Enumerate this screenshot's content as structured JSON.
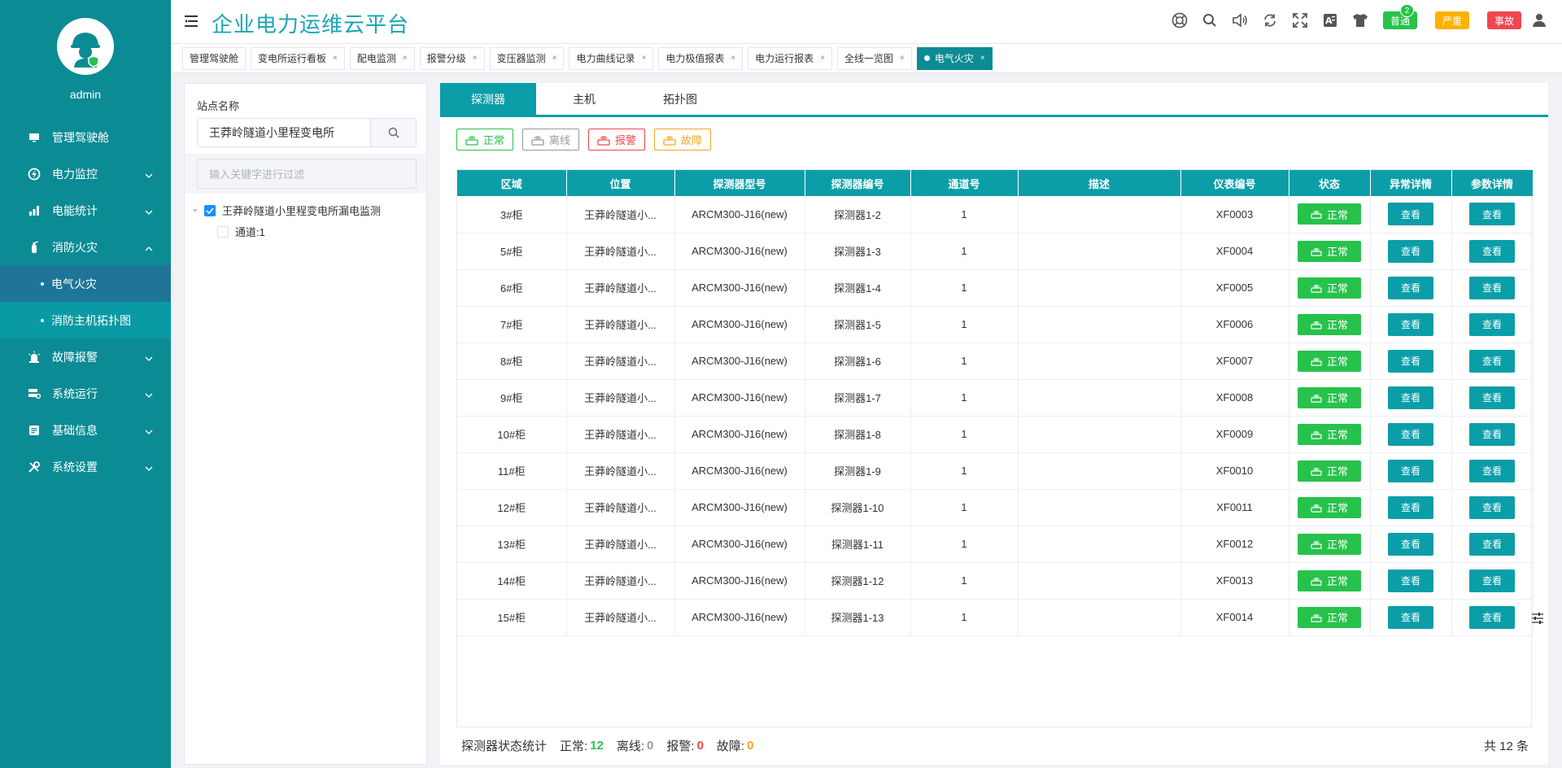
{
  "sidebar": {
    "username": "admin",
    "menu": [
      {
        "label": "管理驾驶舱"
      },
      {
        "label": "电力监控"
      },
      {
        "label": "电能统计"
      },
      {
        "label": "消防火灾"
      },
      {
        "label": "故障报警"
      },
      {
        "label": "系统运行"
      },
      {
        "label": "基础信息"
      },
      {
        "label": "系统设置"
      }
    ],
    "submenu": [
      {
        "label": "电气火灾"
      },
      {
        "label": "消防主机拓扑图"
      }
    ]
  },
  "header": {
    "title": "企业电力运维云平台",
    "badges": {
      "normal": "普通",
      "normal_count": "2",
      "severe": "严重",
      "accident": "事故"
    }
  },
  "tabs": [
    {
      "label": "管理驾驶舱"
    },
    {
      "label": "变电所运行看板",
      "x": "×"
    },
    {
      "label": "配电监测",
      "x": "×"
    },
    {
      "label": "报警分级",
      "x": "×"
    },
    {
      "label": "变压器监测",
      "x": "×"
    },
    {
      "label": "电力曲线记录",
      "x": "×"
    },
    {
      "label": "电力极值报表",
      "x": "×"
    },
    {
      "label": "电力运行报表",
      "x": "×"
    },
    {
      "label": "全线一览图",
      "x": "×"
    },
    {
      "label": "电气火灾",
      "x": "×"
    }
  ],
  "tree": {
    "station_label": "站点名称",
    "station_value": "王莽岭隧道小里程变电所",
    "filter_placeholder": "输入关键字进行过滤",
    "root": "王莽岭隧道小里程变电所漏电监测",
    "child": "通道:1"
  },
  "main": {
    "tabs": [
      "探测器",
      "主机",
      "拓扑图"
    ],
    "legend": {
      "ok": "正常",
      "offline": "离线",
      "alarm": "报警",
      "fault": "故障"
    },
    "columns": [
      "区域",
      "位置",
      "探测器型号",
      "探测器编号",
      "通道号",
      "描述",
      "仪表编号",
      "状态",
      "异常详情",
      "参数详情"
    ],
    "rows": [
      {
        "area": "3#柜",
        "location": "王莽岭隧道小...",
        "model": "ARCM300-J16(new)",
        "code": "探测器1-2",
        "channel": "1",
        "desc": "",
        "meter": "XF0003",
        "status": "正常",
        "detail": "查看",
        "param": "查看"
      },
      {
        "area": "5#柜",
        "location": "王莽岭隧道小...",
        "model": "ARCM300-J16(new)",
        "code": "探测器1-3",
        "channel": "1",
        "desc": "",
        "meter": "XF0004",
        "status": "正常",
        "detail": "查看",
        "param": "查看"
      },
      {
        "area": "6#柜",
        "location": "王莽岭隧道小...",
        "model": "ARCM300-J16(new)",
        "code": "探测器1-4",
        "channel": "1",
        "desc": "",
        "meter": "XF0005",
        "status": "正常",
        "detail": "查看",
        "param": "查看"
      },
      {
        "area": "7#柜",
        "location": "王莽岭隧道小...",
        "model": "ARCM300-J16(new)",
        "code": "探测器1-5",
        "channel": "1",
        "desc": "",
        "meter": "XF0006",
        "status": "正常",
        "detail": "查看",
        "param": "查看"
      },
      {
        "area": "8#柜",
        "location": "王莽岭隧道小...",
        "model": "ARCM300-J16(new)",
        "code": "探测器1-6",
        "channel": "1",
        "desc": "",
        "meter": "XF0007",
        "status": "正常",
        "detail": "查看",
        "param": "查看"
      },
      {
        "area": "9#柜",
        "location": "王莽岭隧道小...",
        "model": "ARCM300-J16(new)",
        "code": "探测器1-7",
        "channel": "1",
        "desc": "",
        "meter": "XF0008",
        "status": "正常",
        "detail": "查看",
        "param": "查看"
      },
      {
        "area": "10#柜",
        "location": "王莽岭隧道小...",
        "model": "ARCM300-J16(new)",
        "code": "探测器1-8",
        "channel": "1",
        "desc": "",
        "meter": "XF0009",
        "status": "正常",
        "detail": "查看",
        "param": "查看"
      },
      {
        "area": "11#柜",
        "location": "王莽岭隧道小...",
        "model": "ARCM300-J16(new)",
        "code": "探测器1-9",
        "channel": "1",
        "desc": "",
        "meter": "XF0010",
        "status": "正常",
        "detail": "查看",
        "param": "查看"
      },
      {
        "area": "12#柜",
        "location": "王莽岭隧道小...",
        "model": "ARCM300-J16(new)",
        "code": "探测器1-10",
        "channel": "1",
        "desc": "",
        "meter": "XF0011",
        "status": "正常",
        "detail": "查看",
        "param": "查看"
      },
      {
        "area": "13#柜",
        "location": "王莽岭隧道小...",
        "model": "ARCM300-J16(new)",
        "code": "探测器1-11",
        "channel": "1",
        "desc": "",
        "meter": "XF0012",
        "status": "正常",
        "detail": "查看",
        "param": "查看"
      },
      {
        "area": "14#柜",
        "location": "王莽岭隧道小...",
        "model": "ARCM300-J16(new)",
        "code": "探测器1-12",
        "channel": "1",
        "desc": "",
        "meter": "XF0013",
        "status": "正常",
        "detail": "查看",
        "param": "查看"
      },
      {
        "area": "15#柜",
        "location": "王莽岭隧道小...",
        "model": "ARCM300-J16(new)",
        "code": "探测器1-13",
        "channel": "1",
        "desc": "",
        "meter": "XF0014",
        "status": "正常",
        "detail": "查看",
        "param": "查看"
      }
    ],
    "stats": {
      "label": "探测器状态统计",
      "normal_label": "正常:",
      "normal": "12",
      "offline_label": "离线:",
      "offline": "0",
      "alarm_label": "报警:",
      "alarm": "0",
      "fault_label": "故障:",
      "fault": "0"
    },
    "total": "共 12 条"
  },
  "colors": {
    "sidebar": "#0b8b94",
    "accent": "#0b9ea8",
    "ok": "#27c24c",
    "alarm": "#f0464e",
    "fault": "#f5a623"
  }
}
